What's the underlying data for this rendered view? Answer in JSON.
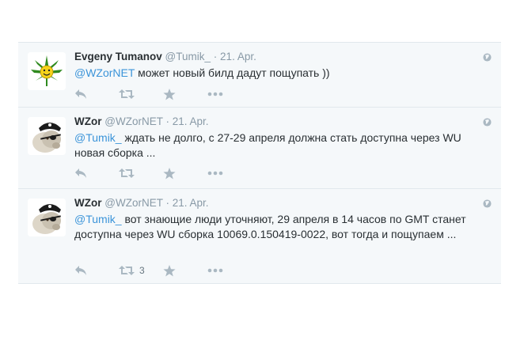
{
  "tweets": [
    {
      "fullname": "Evgeny Tumanov",
      "username": "@Tumik_",
      "separator": "·",
      "time": "21. Apr.",
      "mention": "@WZorNET",
      "text": " может новый билд дадут пощупать ))",
      "retweet_count": "",
      "avatar": "cannabis-leaf-smiley"
    },
    {
      "fullname": "WZor",
      "username": "@WZorNET",
      "separator": "·",
      "time": "21. Apr.",
      "mention": "@Tumik_",
      "text": " ждать не долго, с 27-29 апреля должна стать доступна через WU новая сборка ...",
      "retweet_count": "",
      "avatar": "pirate-sheep"
    },
    {
      "fullname": "WZor",
      "username": "@WZorNET",
      "separator": "·",
      "time": "21. Apr.",
      "mention": "@Tumik_",
      "text": " вот знающие люди уточняют, 29 апреля в 14 часов по GMT станет доступна через WU сборка 10069.0.150419-0022, вот тогда и пощупаем ...",
      "retweet_count": "3",
      "avatar": "pirate-sheep"
    }
  ],
  "icons": {
    "reply": "reply-icon",
    "retweet": "retweet-icon",
    "favorite": "star-icon",
    "more": "more-dots-icon",
    "globe": "globe-icon"
  },
  "colors": {
    "background": "#f5f8fa",
    "link": "#3b94d9",
    "muted": "#8899a6",
    "icon": "#aab8c2"
  }
}
